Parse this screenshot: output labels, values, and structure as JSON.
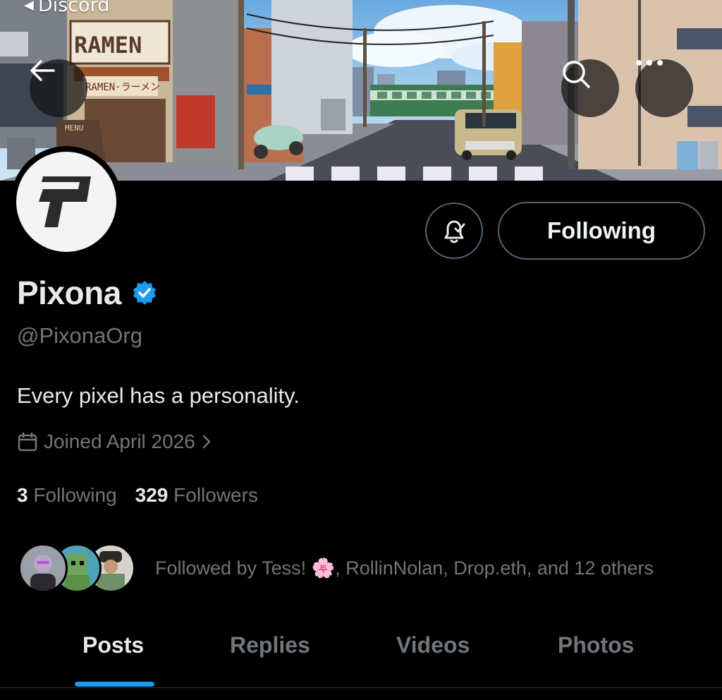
{
  "status_bar": {
    "back_app_label": "Discord"
  },
  "header": {
    "back_icon": "arrow-left-icon",
    "search_icon": "search-icon",
    "more_icon": "more-dots-icon"
  },
  "banner": {
    "shop_sign": "RAMEN",
    "shop_sign_secondary": "RAMEN·ラーメン",
    "menu_board": "MENU"
  },
  "profile": {
    "display_name": "Pixona",
    "handle": "@PixonaOrg",
    "bio": "Every pixel has a personality.",
    "joined": "Joined April 2026",
    "following_count": "3",
    "following_label": "Following",
    "followers_count": "329",
    "followers_label": "Followers",
    "followed_by_text": "Followed by Tess! 🌸, RollinNolan, Drop.eth, and 12 others",
    "verified_color": "#1d9bf0"
  },
  "actions": {
    "notification_icon": "bell-check-icon",
    "following_button_label": "Following"
  },
  "tabs": [
    {
      "label": "Posts",
      "active": true
    },
    {
      "label": "Replies",
      "active": false
    },
    {
      "label": "Videos",
      "active": false
    },
    {
      "label": "Photos",
      "active": false
    }
  ],
  "colors": {
    "accent": "#1d9bf0",
    "muted": "#71767b",
    "background": "#000000"
  }
}
